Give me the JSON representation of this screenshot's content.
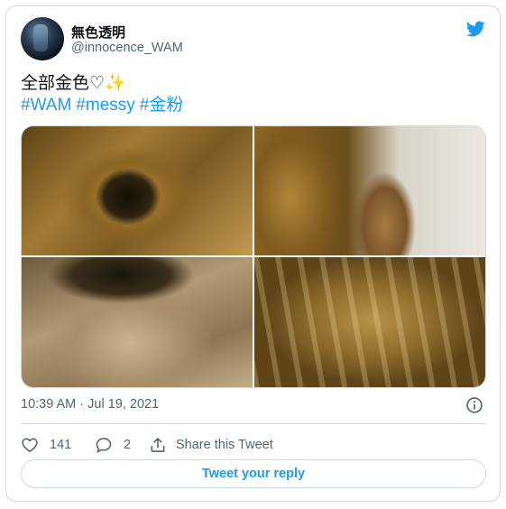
{
  "author": {
    "display_name": "無色透明",
    "handle": "@innocence_WAM"
  },
  "tweet": {
    "text": "全部金色♡✨",
    "hashtags": [
      "#WAM",
      "#messy",
      "#金粉"
    ]
  },
  "meta": {
    "timestamp": "10:39 AM · Jul 19, 2021"
  },
  "actions": {
    "likes": "141",
    "replies": "2",
    "share_label": "Share this Tweet"
  },
  "reply_button": {
    "label": "Tweet your reply"
  },
  "colors": {
    "accent": "#1d9bf0",
    "secondary_text": "#536471",
    "border": "#cfd9de",
    "primary_text": "#0f1419"
  },
  "icons": {
    "brand": "twitter-bird-icon",
    "info": "info-icon",
    "like": "heart-icon",
    "reply": "speech-bubble-icon",
    "share": "share-upload-icon"
  }
}
